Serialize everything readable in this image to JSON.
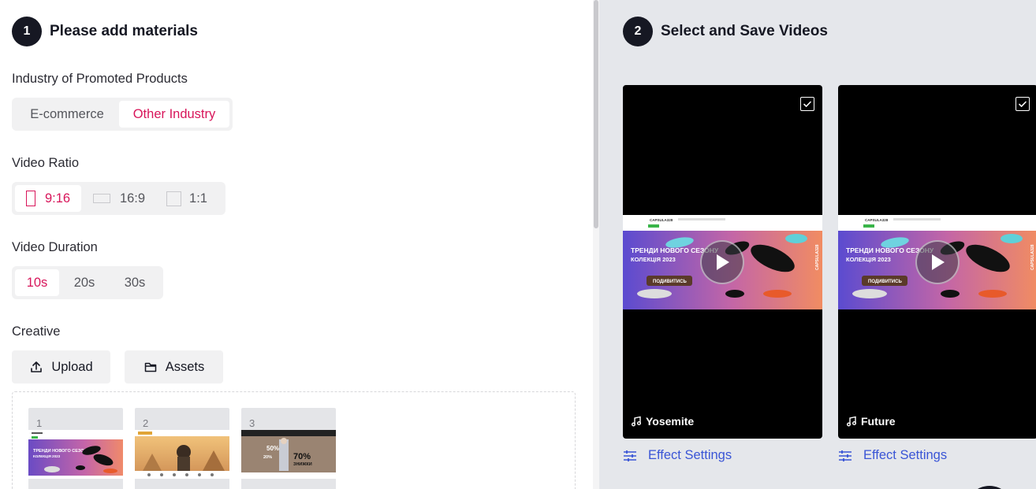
{
  "step1": {
    "number": "1",
    "title": "Please add materials"
  },
  "step2": {
    "number": "2",
    "title": "Select and Save Videos"
  },
  "industry": {
    "label": "Industry of Promoted Products",
    "options": [
      "E-commerce",
      "Other Industry"
    ],
    "selected": "Other Industry"
  },
  "ratio": {
    "label": "Video Ratio",
    "options": [
      "9:16",
      "16:9",
      "1:1"
    ],
    "selected": "9:16"
  },
  "duration": {
    "label": "Video Duration",
    "options": [
      "10s",
      "20s",
      "30s"
    ],
    "selected": "10s"
  },
  "creative": {
    "label": "Creative",
    "upload_label": "Upload",
    "assets_label": "Assets",
    "thumbnails": [
      {
        "index": "1",
        "banner_text": "ТРЕНДИ НОВОГО СЕЗОНУ",
        "banner_sub": "КОЛЕКЦІЯ 2023"
      },
      {
        "index": "2"
      },
      {
        "index": "3",
        "promo_1": "50%",
        "promo_2": "20%",
        "promo_3": "70%",
        "promo_4": "ЗНИЖКИ"
      }
    ]
  },
  "videos": [
    {
      "music": "Yosemite",
      "effect_label": "Effect Settings",
      "selected": true,
      "banner_title": "ТРЕНДИ НОВОГО СЕЗОНУ",
      "banner_sub": "КОЛЕКЦІЯ 2023",
      "banner_cta": "ПОДИВИТИСЬ",
      "brand": "CAPSULA328"
    },
    {
      "music": "Future",
      "effect_label": "Effect Settings",
      "selected": true,
      "banner_title": "ТРЕНДИ НОВОГО СЕЗОНУ",
      "banner_sub": "КОЛЕКЦІЯ 2023",
      "banner_cta": "ПОДИВИТИСЬ",
      "brand": "CAPSULA328"
    }
  ],
  "colors": {
    "accent": "#d8155a",
    "link": "#3a55d6",
    "step_badge": "#161823",
    "right_panel_bg": "#e5e7eb"
  }
}
